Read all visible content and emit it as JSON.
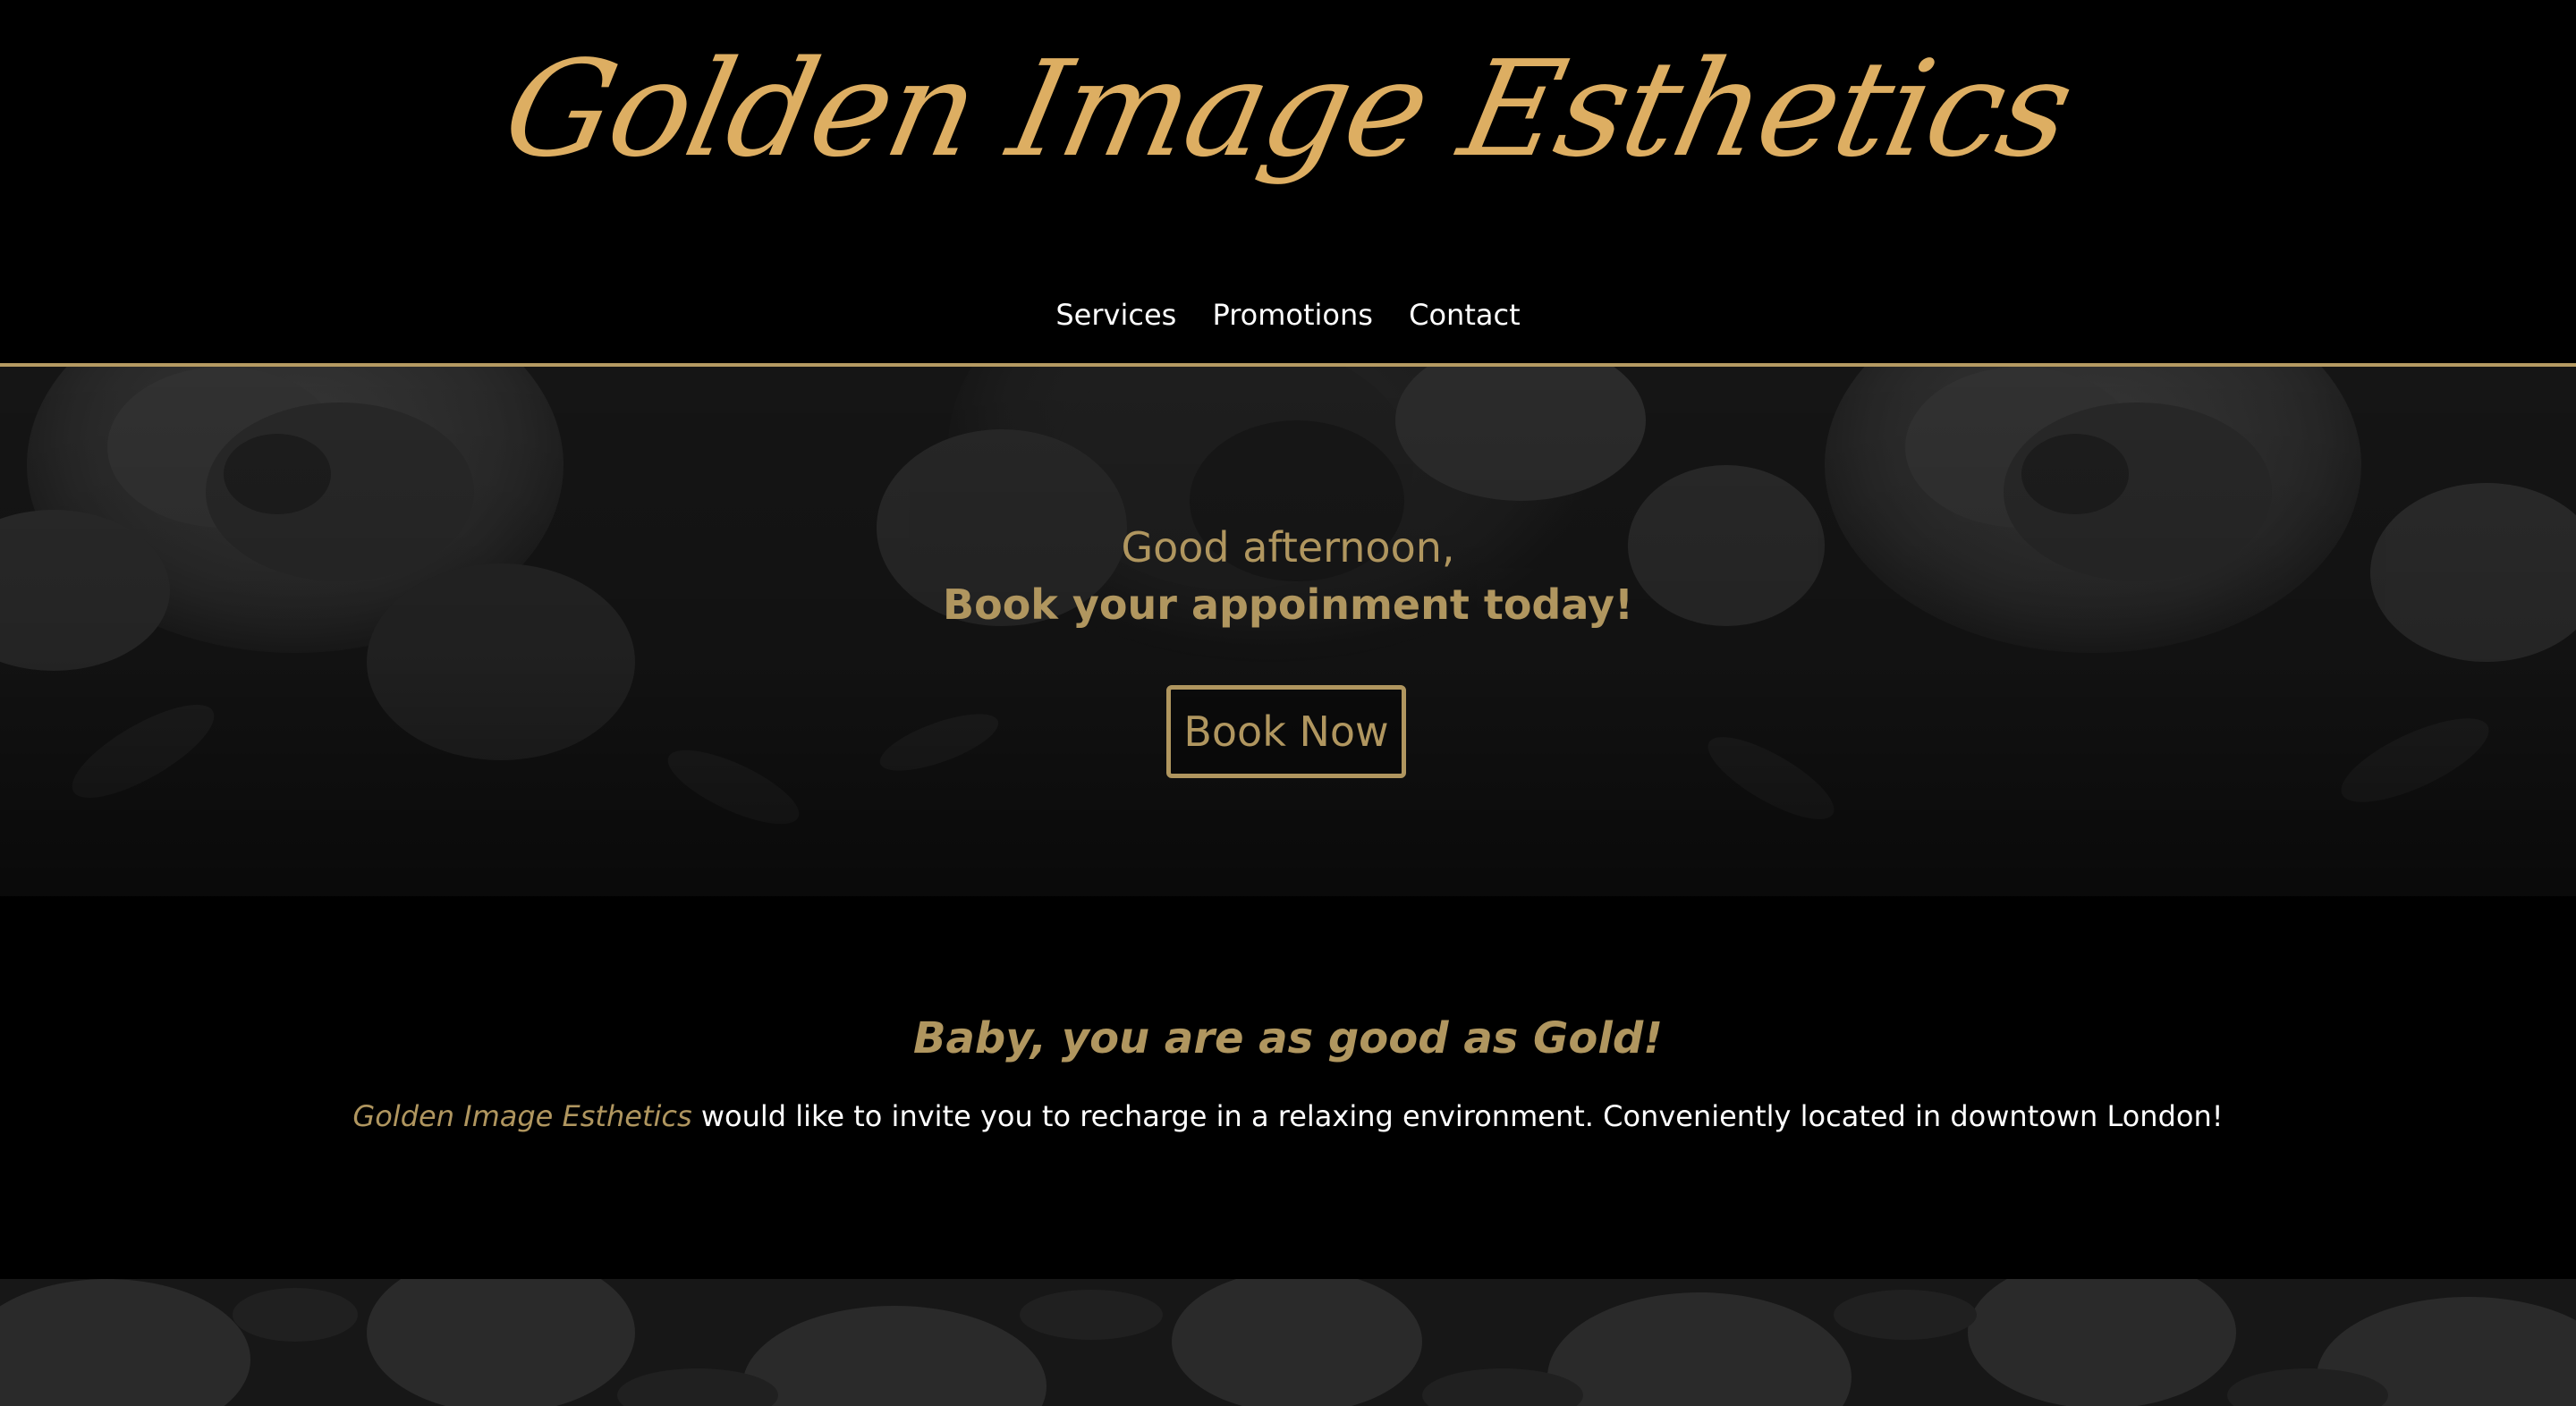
{
  "site": {
    "brand": "Golden Image Esthetics"
  },
  "nav": {
    "items": [
      {
        "label": "Services"
      },
      {
        "label": "Promotions"
      },
      {
        "label": "Contact"
      }
    ]
  },
  "hero": {
    "greeting": "Good afternoon,",
    "headline": "Book your appoinment today!",
    "cta_label": "Book Now",
    "background": "floral-pattern"
  },
  "intro": {
    "tagline": "Baby, you are as good as Gold!",
    "brand_mention": "Golden Image Esthetics",
    "body": " would like to invite you to recharge in a relaxing environment. Conveniently located in downtown London!"
  },
  "colors": {
    "gold": "#DDAE62",
    "muted_gold": "#B0965F",
    "divider": "#B59A62",
    "background": "#000000",
    "text": "#FFFFFF"
  }
}
